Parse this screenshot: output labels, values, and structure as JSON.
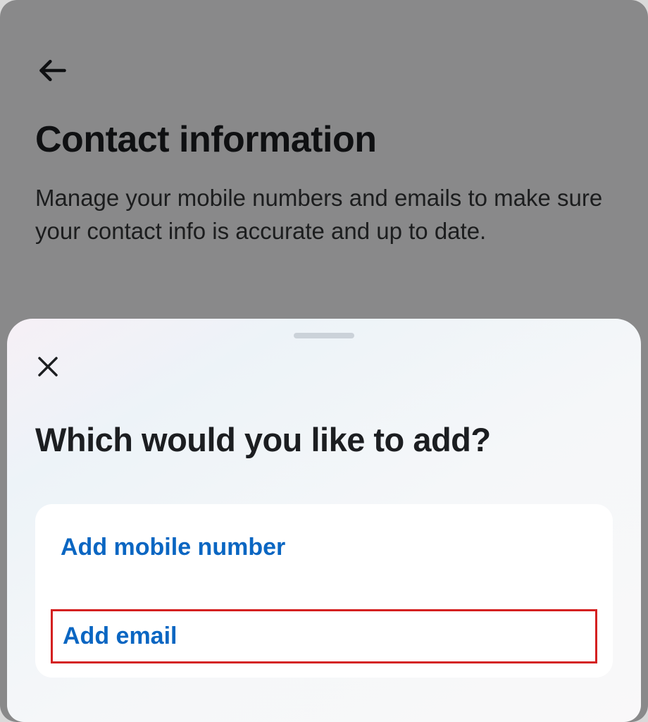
{
  "page": {
    "title": "Contact information",
    "subtitle": "Manage your mobile numbers and emails to make sure your contact info is accurate and up to date."
  },
  "sheet": {
    "title": "Which would you like to add?",
    "options": [
      {
        "label": "Add mobile number"
      },
      {
        "label": "Add email"
      }
    ]
  }
}
